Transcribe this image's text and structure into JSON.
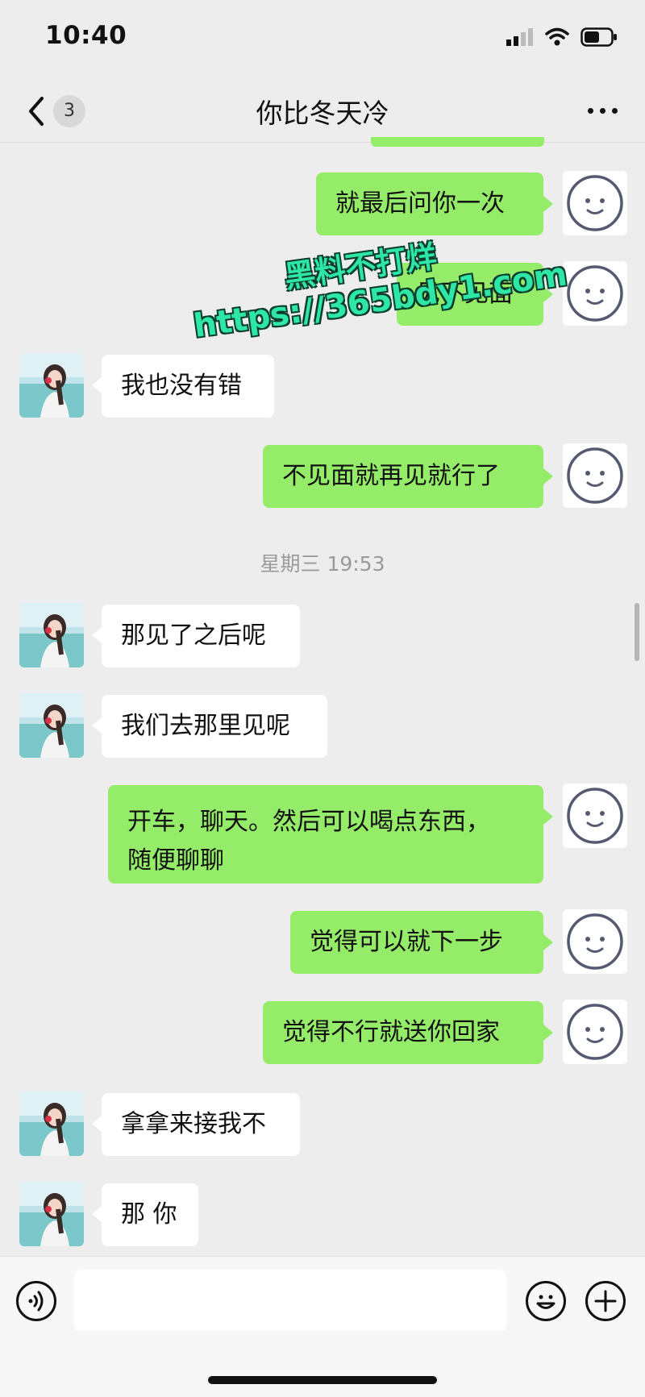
{
  "status": {
    "time": "10:40"
  },
  "header": {
    "back_count": "3",
    "title": "你比冬天冷"
  },
  "messages": [
    {
      "side": "out",
      "text": "就最后问你一次"
    },
    {
      "side": "out",
      "text": "见不见面"
    },
    {
      "side": "in",
      "text": "我也没有错"
    },
    {
      "side": "out",
      "text": "不见面就再见就行了"
    },
    {
      "side": "in",
      "text": "那见了之后呢"
    },
    {
      "side": "in",
      "text": "我们去那里见呢"
    },
    {
      "side": "out",
      "text_line1": "开车，聊天。然后可以喝点东西，",
      "text_line2": "随便聊聊"
    },
    {
      "side": "out",
      "text": "觉得可以就下一步"
    },
    {
      "side": "out",
      "text": "觉得不行就送你回家"
    },
    {
      "side": "in",
      "text": "拿拿来接我不"
    },
    {
      "side": "in",
      "text": "那 你"
    }
  ],
  "timestamp": "星期三 19:53",
  "watermark": {
    "line1": "黑料不打烊",
    "line2": "https://365bdy1.com"
  },
  "colors": {
    "outgoing_bubble": "#95ec69",
    "incoming_bubble": "#ffffff",
    "background": "#ededed"
  },
  "icons": [
    "signal-icon",
    "wifi-icon",
    "battery-icon",
    "back-chevron-icon",
    "more-icon",
    "voice-icon",
    "emoji-icon",
    "plus-icon"
  ]
}
